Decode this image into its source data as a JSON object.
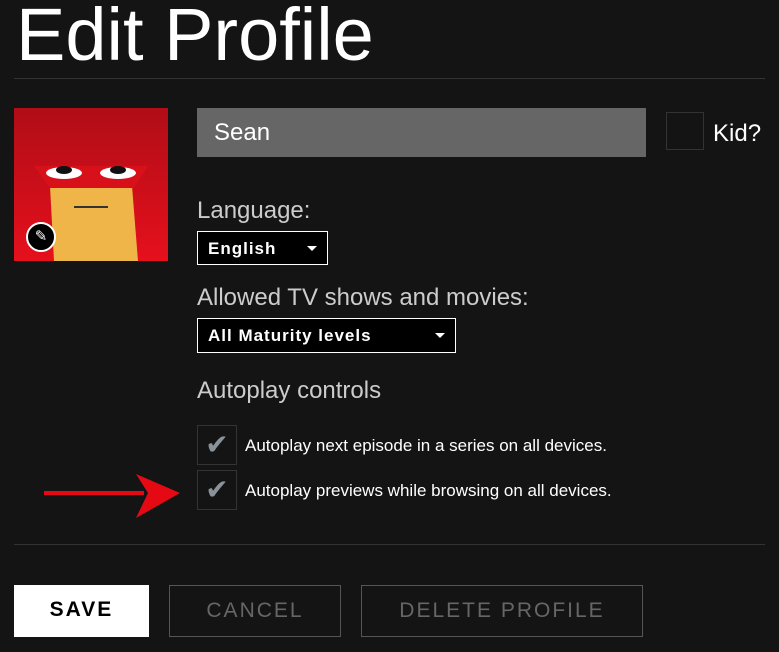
{
  "title": "Edit Profile",
  "profile": {
    "name": "Sean",
    "kid_label": "Kid?",
    "kid_checked": false
  },
  "language": {
    "label": "Language:",
    "value": "English"
  },
  "maturity": {
    "label": "Allowed TV shows and movies:",
    "value": "All Maturity levels"
  },
  "autoplay": {
    "label": "Autoplay controls",
    "options": [
      {
        "label": "Autoplay next episode in a series on all devices.",
        "checked": true
      },
      {
        "label": "Autoplay previews while browsing on all devices.",
        "checked": true
      }
    ]
  },
  "buttons": {
    "save": "SAVE",
    "cancel": "CANCEL",
    "delete": "DELETE PROFILE"
  },
  "annotation": {
    "arrow_color": "#e50914"
  }
}
